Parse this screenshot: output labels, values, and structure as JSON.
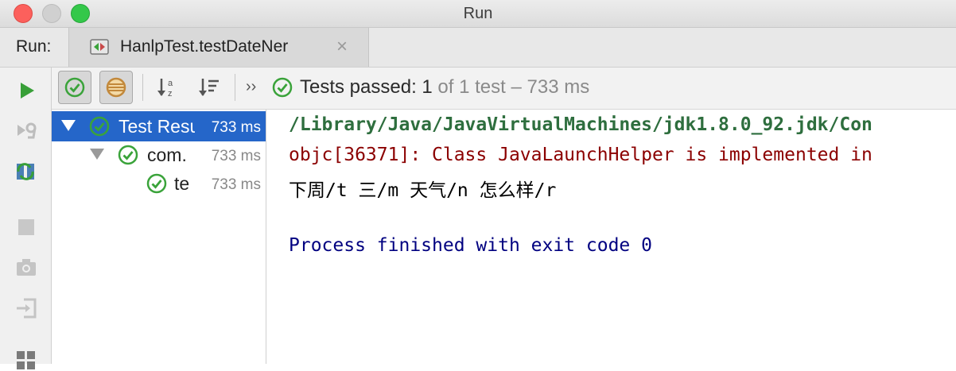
{
  "window": {
    "title": "Run"
  },
  "tabbar": {
    "run_label": "Run:",
    "tab_label": "HanlpTest.testDateNer",
    "close_glyph": "×"
  },
  "toolbar": {
    "more_glyph": "››",
    "status_bold": "Tests passed: 1",
    "status_rest": " of 1 test – 733 ms"
  },
  "left_toolbar": {
    "icons": [
      "run-icon",
      "rerun-failed-icon",
      "toggle-autotest-icon",
      "stop-icon",
      "camera-icon",
      "import-icon",
      "layout-icon"
    ]
  },
  "tree": {
    "rows": [
      {
        "label": "Test Results",
        "time": "733 ms",
        "selected": true
      },
      {
        "label": "com.",
        "time": "733 ms",
        "selected": false
      },
      {
        "label": "te",
        "time": "733 ms",
        "selected": false
      }
    ]
  },
  "console": {
    "lines": [
      {
        "text": "/Library/Java/JavaVirtualMachines/jdk1.8.0_92.jdk/Con",
        "color": "#2e6e3e"
      },
      {
        "text": "objc[36371]: Class JavaLaunchHelper is implemented in",
        "color": "#8b0000"
      },
      {
        "text": "下周/t 三/m 天气/n 怎么样/r",
        "color": "#000000"
      },
      {
        "text": "",
        "color": "#000000"
      },
      {
        "text": "Process finished with exit code 0",
        "color": "#000080"
      }
    ]
  },
  "colors": {
    "success": "#3aa33a",
    "selection": "#2566c9",
    "run_green": "#389f38"
  }
}
